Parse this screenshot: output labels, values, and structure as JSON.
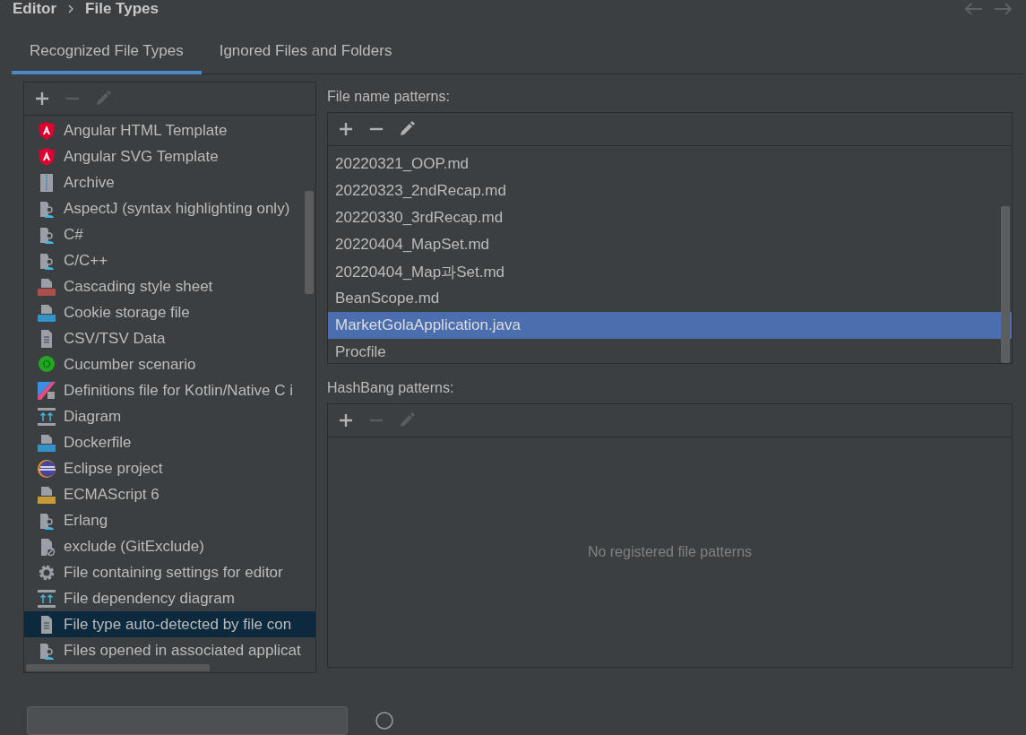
{
  "breadcrumb": [
    {
      "label": "Editor"
    },
    {
      "label": "File Types"
    }
  ],
  "nav": [
    {
      "kind": "back",
      "disabled": true
    },
    {
      "kind": "forward",
      "disabled": true
    }
  ],
  "tabs": [
    {
      "label": "Recognized File Types",
      "selected": true
    },
    {
      "label": "Ignored Files and Folders",
      "selected": false
    }
  ],
  "file_types": {
    "toolbar": [
      {
        "kind": "add",
        "disabled": false
      },
      {
        "kind": "remove",
        "disabled": true
      },
      {
        "kind": "edit",
        "disabled": true
      }
    ],
    "items": [
      {
        "kind": "angular",
        "label": "Angular HTML Template",
        "selected": false
      },
      {
        "kind": "angular",
        "label": "Angular SVG Template",
        "selected": false
      },
      {
        "kind": "archive",
        "label": "Archive",
        "selected": false
      },
      {
        "kind": "person",
        "label": "AspectJ (syntax highlighting only)",
        "selected": false
      },
      {
        "kind": "person",
        "label": "C#",
        "selected": false
      },
      {
        "kind": "person",
        "label": "C/C++",
        "selected": false
      },
      {
        "kind": "css",
        "label": "Cascading style sheet",
        "selected": false
      },
      {
        "kind": "api",
        "label": "Cookie storage file",
        "selected": false
      },
      {
        "kind": "text",
        "label": "CSV/TSV Data",
        "selected": false
      },
      {
        "kind": "cucumber",
        "label": "Cucumber scenario",
        "selected": false
      },
      {
        "kind": "kotlin",
        "label": "Definitions file for Kotlin/Native C i",
        "selected": false
      },
      {
        "kind": "diagram",
        "label": "Diagram",
        "selected": false
      },
      {
        "kind": "docker",
        "label": "Dockerfile",
        "selected": false
      },
      {
        "kind": "eclipse",
        "label": "Eclipse project",
        "selected": false
      },
      {
        "kind": "js",
        "label": "ECMAScript 6",
        "selected": false
      },
      {
        "kind": "person",
        "label": "Erlang",
        "selected": false
      },
      {
        "kind": "exclude",
        "label": "exclude (GitExclude)",
        "selected": false
      },
      {
        "kind": "gear",
        "label": "File containing settings for editor",
        "selected": false
      },
      {
        "kind": "diagram",
        "label": "File dependency diagram",
        "selected": false
      },
      {
        "kind": "text",
        "label": "File type auto-detected by file con",
        "selected": true
      },
      {
        "kind": "person",
        "label": "Files opened in associated applicat",
        "selected": false
      }
    ]
  },
  "file_name_patterns": {
    "title": "File name patterns:",
    "toolbar": [
      {
        "kind": "add",
        "disabled": false
      },
      {
        "kind": "remove",
        "disabled": false
      },
      {
        "kind": "edit",
        "disabled": false
      }
    ],
    "items": [
      {
        "label": "20220321_OOP.md",
        "selected": false
      },
      {
        "label": "20220323_2ndRecap.md",
        "selected": false
      },
      {
        "label": "20220330_3rdRecap.md",
        "selected": false
      },
      {
        "label": "20220404_MapSet.md",
        "selected": false
      },
      {
        "label": "20220404_Map과Set.md",
        "selected": false
      },
      {
        "label": "BeanScope.md",
        "selected": false
      },
      {
        "label": "MarketGolaApplication.java",
        "selected": true
      },
      {
        "label": "Procfile",
        "selected": false
      }
    ]
  },
  "hashbang_patterns": {
    "title": "HashBang patterns:",
    "toolbar": [
      {
        "kind": "add",
        "disabled": false
      },
      {
        "kind": "remove",
        "disabled": true
      },
      {
        "kind": "edit",
        "disabled": true
      }
    ],
    "empty_text": "No registered file patterns"
  }
}
